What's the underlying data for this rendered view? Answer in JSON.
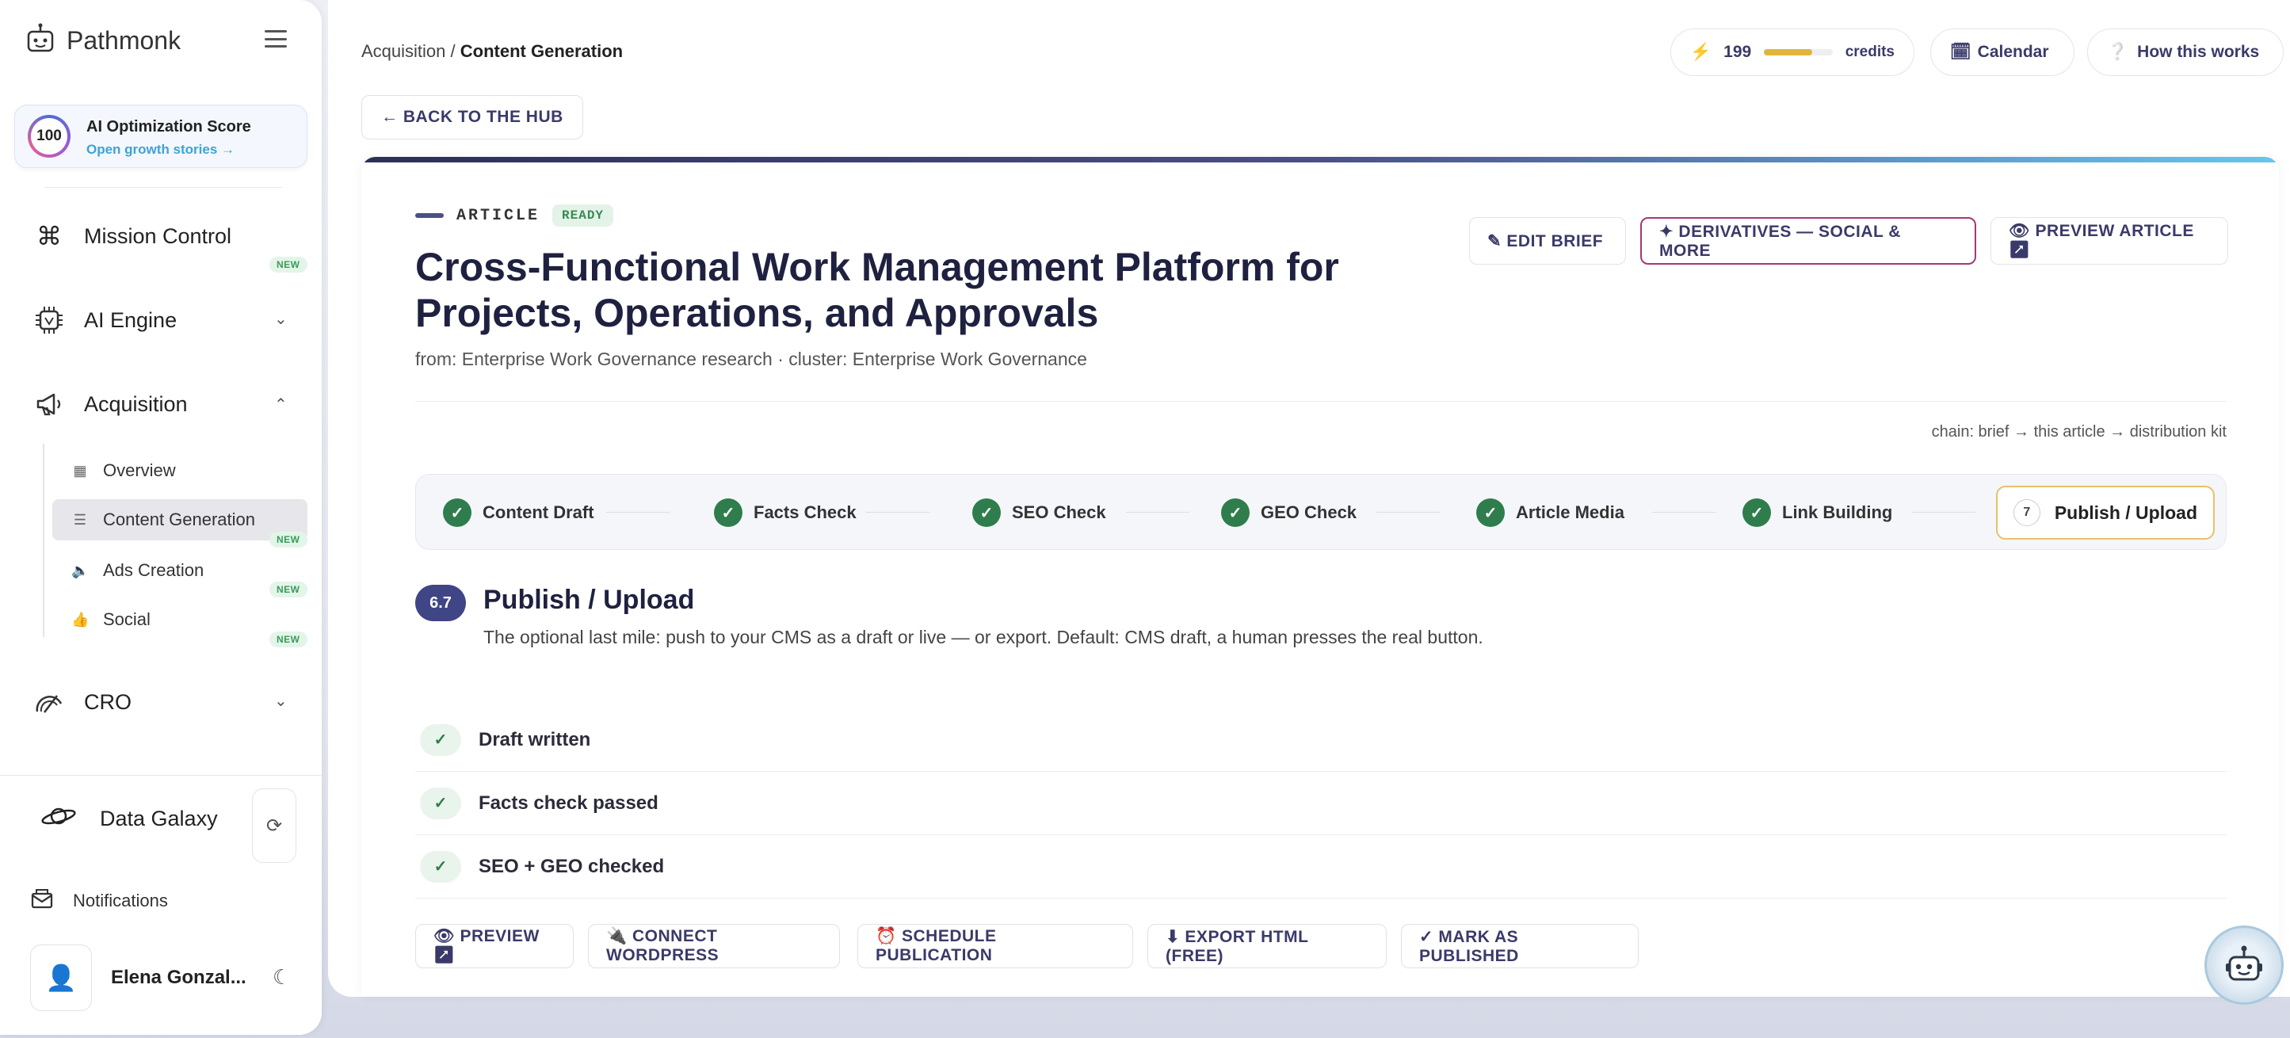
{
  "app": {
    "name": "Pathmonk"
  },
  "score": {
    "value": "100",
    "title": "AI Optimization Score",
    "link": "Open growth stories →"
  },
  "nav": {
    "mission_control": "Mission Control",
    "ai_engine": "AI Engine",
    "acquisition": "Acquisition",
    "cro": "CRO",
    "new_badge": "NEW",
    "sub_items": [
      "Overview",
      "Content Generation",
      "Ads Creation",
      "Social"
    ]
  },
  "data_galaxy": "Data Galaxy",
  "notifications": "Notifications",
  "user": {
    "name": "Elena Gonzal..."
  },
  "breadcrumb": {
    "parent": "Acquisition",
    "separator": "/",
    "current": "Content Generation"
  },
  "topbar": {
    "credits_value": "199",
    "credits_label": "credits",
    "credits_fraction": 0.7,
    "calendar": "Calendar",
    "how": "How this works"
  },
  "back": "← BACK TO THE HUB",
  "article": {
    "kind": "ARTICLE",
    "status": "READY",
    "title": "Cross-Functional Work Management Platform for Projects, Operations, and Approvals",
    "from": "from: Enterprise Work Governance research · cluster: Enterprise Work Governance",
    "actions": {
      "edit": "✎ EDIT BRIEF",
      "derivatives": "✦ DERIVATIVES — SOCIAL & MORE",
      "preview": "👁 PREVIEW ARTICLE ↗"
    },
    "chain": "chain: brief → this article → distribution kit"
  },
  "steps": [
    {
      "label": "Content Draft",
      "done": true
    },
    {
      "label": "Facts Check",
      "done": true
    },
    {
      "label": "SEO Check",
      "done": true
    },
    {
      "label": "GEO Check",
      "done": true
    },
    {
      "label": "Article Media",
      "done": true
    },
    {
      "label": "Link Building",
      "done": true
    },
    {
      "label": "Publish / Upload",
      "number": "7",
      "done": false
    }
  ],
  "section": {
    "badge": "6.7",
    "title": "Publish / Upload",
    "desc": "The optional last mile: push to your CMS as a draft or live — or export. Default: CMS draft, a human presses the real button."
  },
  "checks": [
    "Draft written",
    "Facts check passed",
    "SEO + GEO checked"
  ],
  "bottom_actions": [
    "👁 PREVIEW ↗",
    "🔌 CONNECT WORDPRESS",
    "⏰ SCHEDULE PUBLICATION",
    "⬇ EXPORT HTML (FREE)",
    "✓ MARK AS PUBLISHED"
  ],
  "colors": {
    "accent": "#3f4585",
    "success": "#2f7d4c",
    "highlight_border": "#a23a74",
    "active_step_border": "#e6c16a"
  }
}
